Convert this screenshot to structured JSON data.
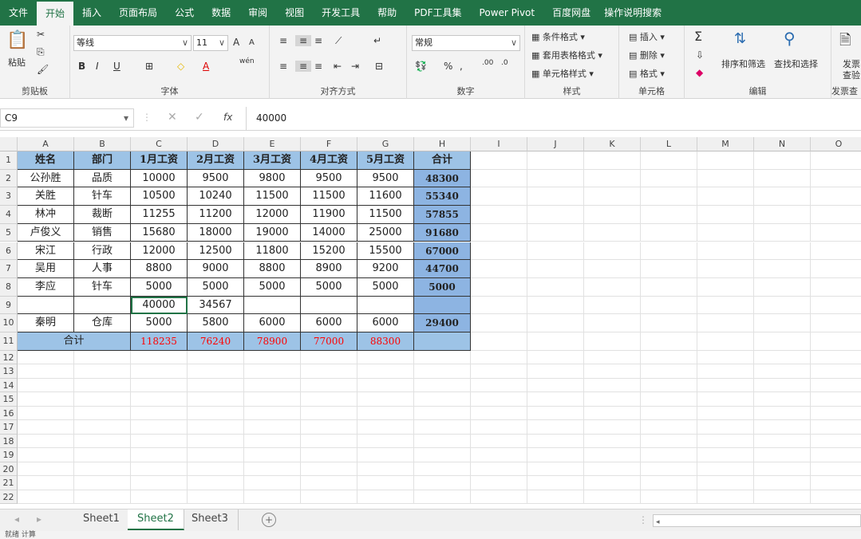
{
  "menu": [
    "文件",
    "开始",
    "插入",
    "页面布局",
    "公式",
    "数据",
    "审阅",
    "视图",
    "开发工具",
    "帮助",
    "PDF工具集",
    "Power Pivot",
    "百度网盘",
    "操作说明搜索"
  ],
  "ribbon": {
    "clipboard": {
      "paste": "粘贴",
      "label": "剪贴板"
    },
    "font": {
      "name": "等线",
      "size": "11",
      "bold": "B",
      "italic": "I",
      "underline": "U",
      "grow": "A",
      "shrink": "A",
      "label": "字体",
      "pinyin": "wén"
    },
    "align": {
      "label": "对齐方式"
    },
    "number": {
      "format": "常规",
      "percent": "%",
      "label": "数字"
    },
    "styles": {
      "cond": "条件格式",
      "table": "套用表格格式",
      "cell": "单元格样式",
      "label": "样式"
    },
    "cells": {
      "insert": "插入",
      "delete": "删除",
      "format": "格式",
      "label": "单元格"
    },
    "edit": {
      "sort": "排序和筛选",
      "find": "查找和选择",
      "label": "编辑"
    },
    "invoice": {
      "line1": "发票",
      "line2": "查验",
      "label": "发票查"
    }
  },
  "formula": {
    "namebox": "C9",
    "value": "40000",
    "fx": "fx"
  },
  "columns": [
    "A",
    "B",
    "C",
    "D",
    "E",
    "F",
    "G",
    "H",
    "I",
    "J",
    "K",
    "L",
    "M",
    "N",
    "O"
  ],
  "rows": [
    [
      "姓名",
      "部门",
      "1月工资",
      "2月工资",
      "3月工资",
      "4月工资",
      "5月工资",
      "合计"
    ],
    [
      "公孙胜",
      "品质",
      "10000",
      "9500",
      "9800",
      "9500",
      "9500",
      "48300"
    ],
    [
      "关胜",
      "针车",
      "10500",
      "10240",
      "11500",
      "11500",
      "11600",
      "55340"
    ],
    [
      "林冲",
      "裁断",
      "11255",
      "11200",
      "12000",
      "11900",
      "11500",
      "57855"
    ],
    [
      "卢俊义",
      "销售",
      "15680",
      "18000",
      "19000",
      "14000",
      "25000",
      "91680"
    ],
    [
      "宋江",
      "行政",
      "12000",
      "12500",
      "11800",
      "15200",
      "15500",
      "67000"
    ],
    [
      "吴用",
      "人事",
      "8800",
      "9000",
      "8800",
      "8900",
      "9200",
      "44700"
    ],
    [
      "李应",
      "针车",
      "5000",
      "5000",
      "5000",
      "5000",
      "5000",
      "5000"
    ],
    [
      "",
      "",
      "40000",
      "34567",
      "",
      "",
      "",
      ""
    ],
    [
      "秦明",
      "仓库",
      "5000",
      "5800",
      "6000",
      "6000",
      "6000",
      "29400"
    ],
    [
      "合计",
      "",
      "118235",
      "76240",
      "78900",
      "77000",
      "88300",
      ""
    ]
  ],
  "row_numbers": [
    "1",
    "2",
    "3",
    "4",
    "5",
    "6",
    "7",
    "8",
    "9",
    "10",
    "11",
    "12",
    "13",
    "14",
    "15",
    "16",
    "17",
    "18",
    "19",
    "20",
    "21",
    "22"
  ],
  "sheets": [
    "Sheet1",
    "Sheet2",
    "Sheet3"
  ],
  "active_sheet": "Sheet2",
  "status": "就绪   计算",
  "colors": {
    "green": "#217346",
    "header_blue": "#9dc3e6",
    "total_red": "#ff0000",
    "sum_blue": "#8db4e2"
  }
}
